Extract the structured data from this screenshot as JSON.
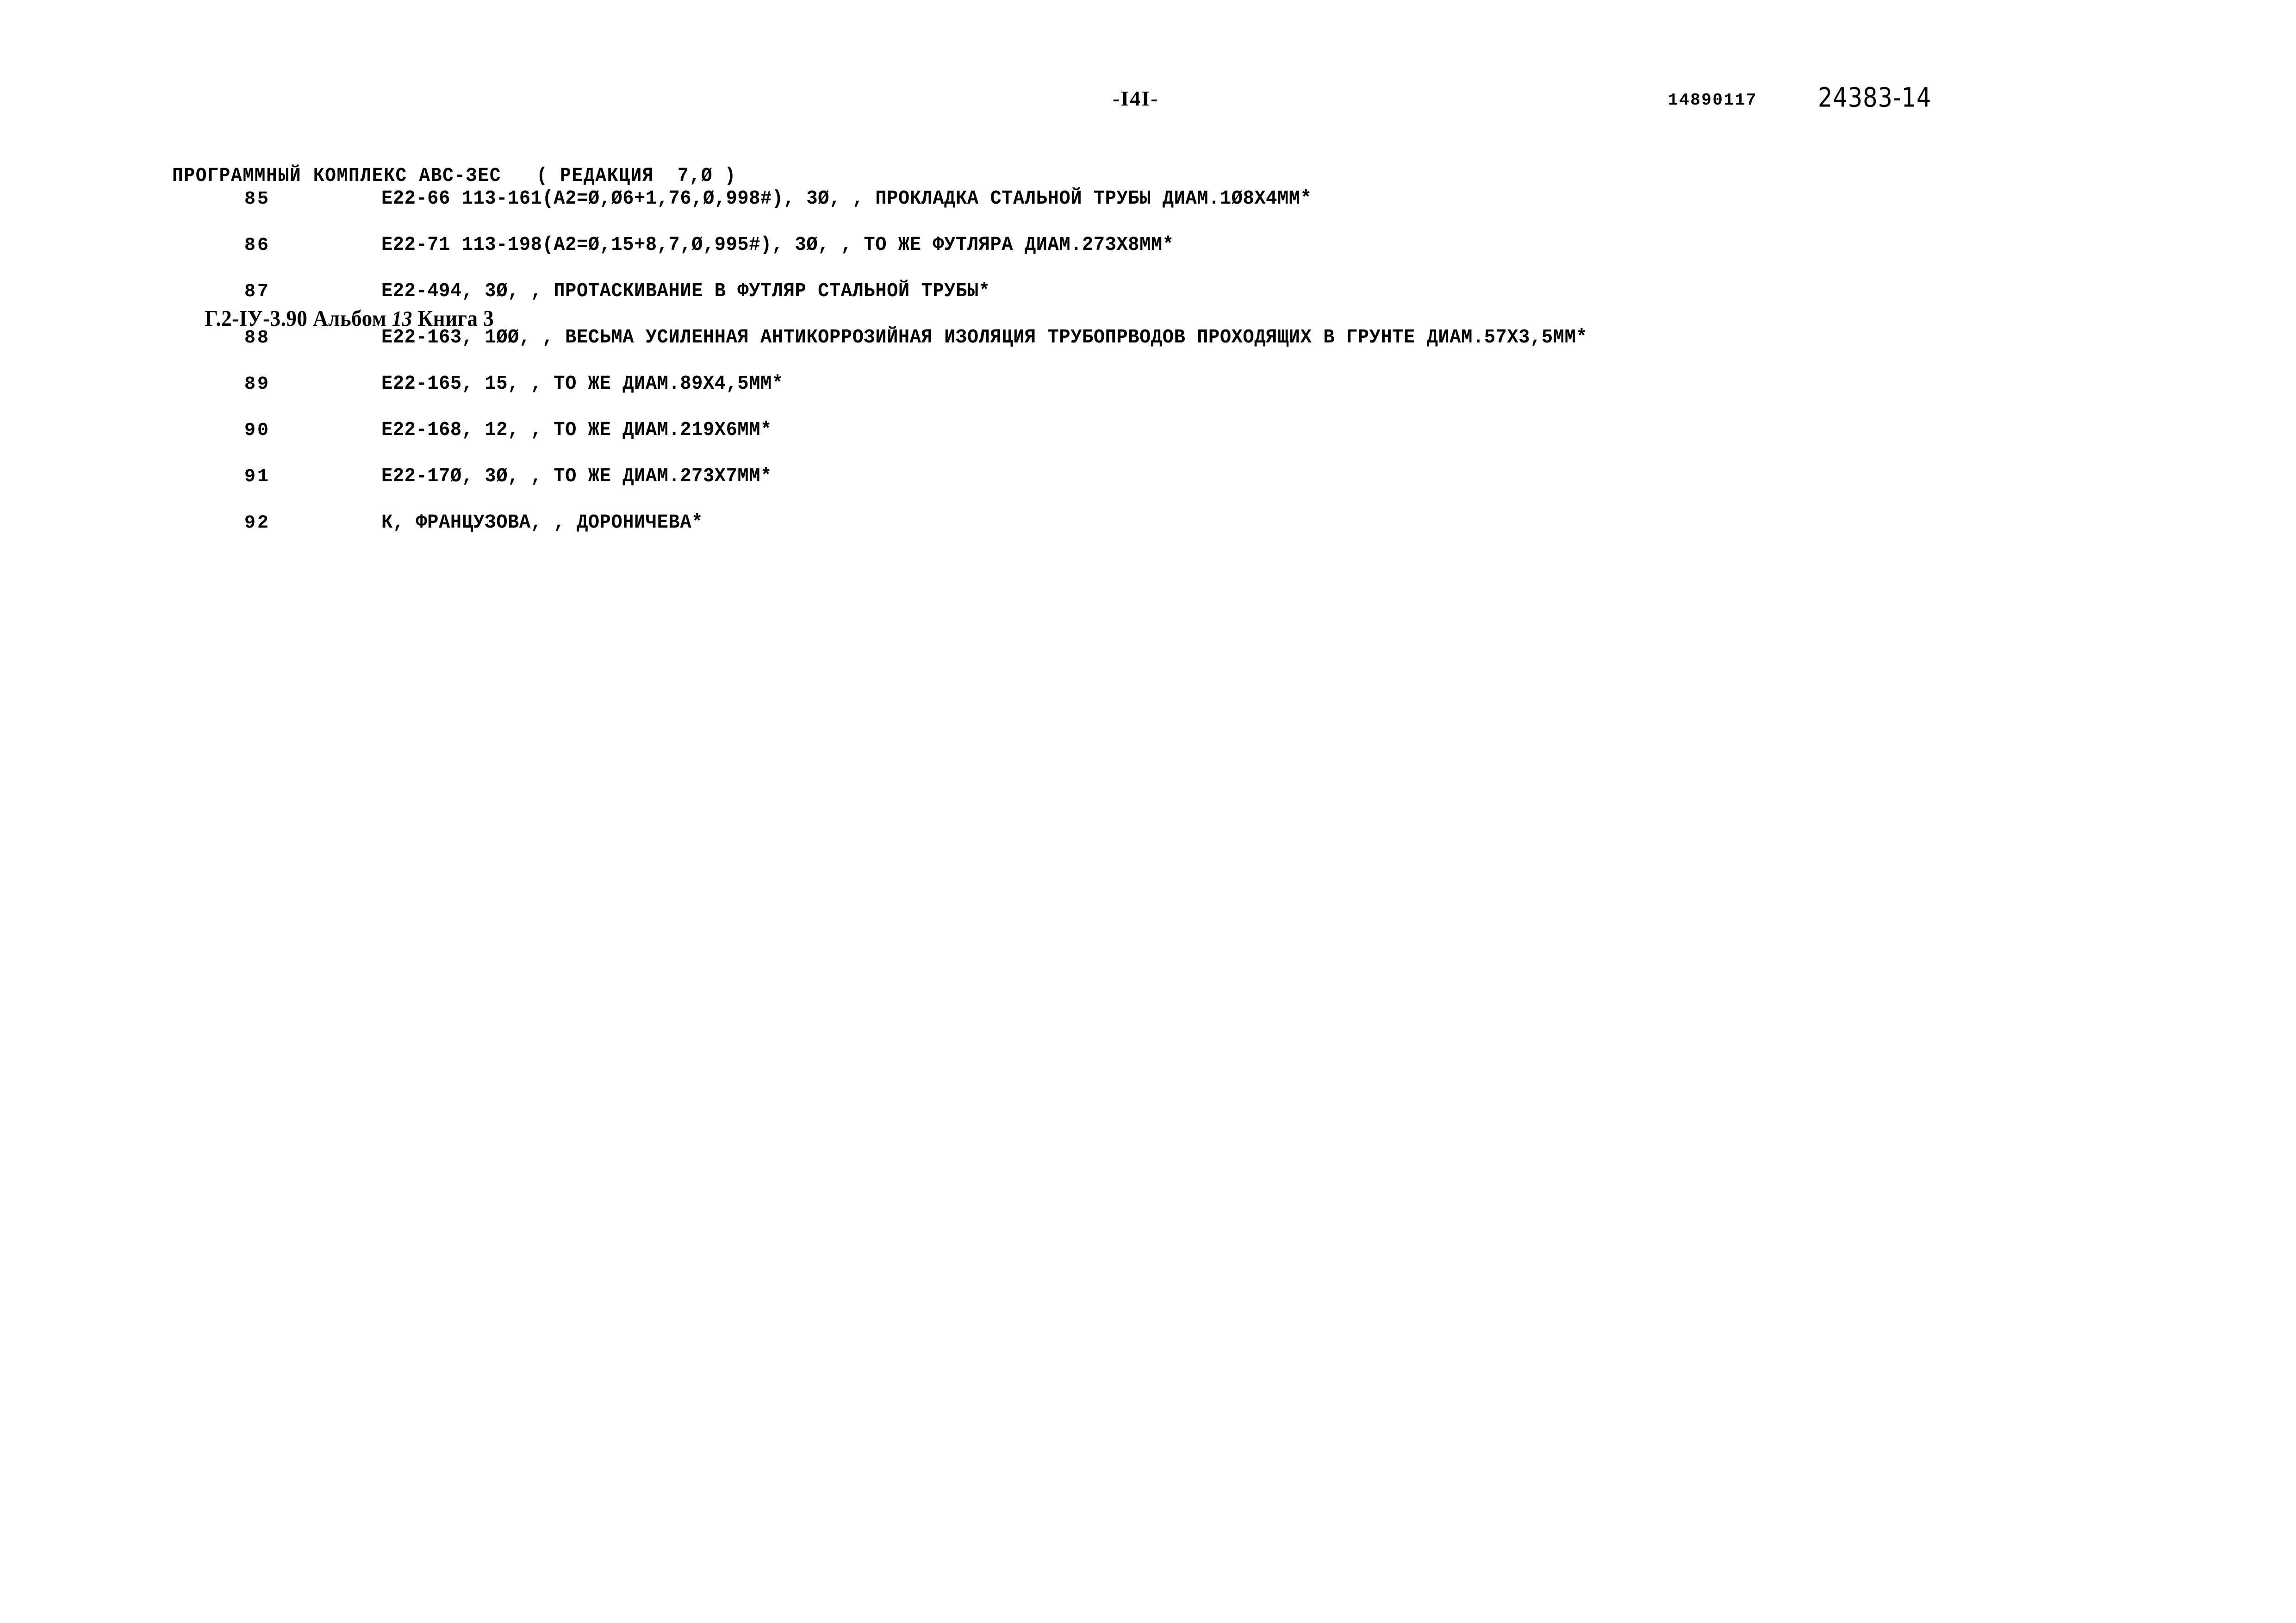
{
  "header": {
    "program_title": "ПРОГРАММНЫЙ КОМПЛЕКС АВС-ЗЕС   ( РЕДАКЦИЯ  7,Ø )",
    "document_code_prefix": "Г.2-IУ-3.90 Альбом ",
    "album_number": "13",
    "document_code_suffix": " Книга 3",
    "page_number": "-I4I-",
    "listing_code": "14890117",
    "stamp_code": "24383-14"
  },
  "listing": {
    "rows": [
      {
        "num": "85",
        "text": "Е22-66 113-161(А2=Ø,Ø6+1,76,Ø,998#), 3Ø, , ПРОКЛАДКА СТАЛЬНОЙ ТРУБЫ ДИАМ.1Ø8Х4ММ*"
      },
      {
        "num": "86",
        "text": "Е22-71 113-198(А2=Ø,15+8,7,Ø,995#), 3Ø, , ТО ЖЕ ФУТЛЯРА ДИАМ.273Х8ММ*"
      },
      {
        "num": "87",
        "text": "Е22-494, 3Ø, , ПРОТАСКИВАНИЕ В ФУТЛЯР СТАЛЬНОЙ ТРУБЫ*"
      },
      {
        "num": "88",
        "text": "Е22-163, 1ØØ, , ВЕСЬМА УСИЛЕННАЯ АНТИКОРРОЗИЙНАЯ ИЗОЛЯЦИЯ ТРУБОПРВОДОВ ПРОХОДЯЩИХ В ГРУНТЕ ДИАМ.57Х3,5ММ*"
      },
      {
        "num": "89",
        "text": "Е22-165, 15, , ТО ЖЕ ДИАМ.89Х4,5ММ*"
      },
      {
        "num": "90",
        "text": "Е22-168, 12, , ТО ЖЕ ДИАМ.219Х6ММ*"
      },
      {
        "num": "91",
        "text": "Е22-17Ø, 3Ø, , ТО ЖЕ ДИАМ.273Х7ММ*"
      },
      {
        "num": "92",
        "text": "К, ФРАНЦУЗОВА, , ДОРОНИЧЕВА*"
      }
    ]
  }
}
